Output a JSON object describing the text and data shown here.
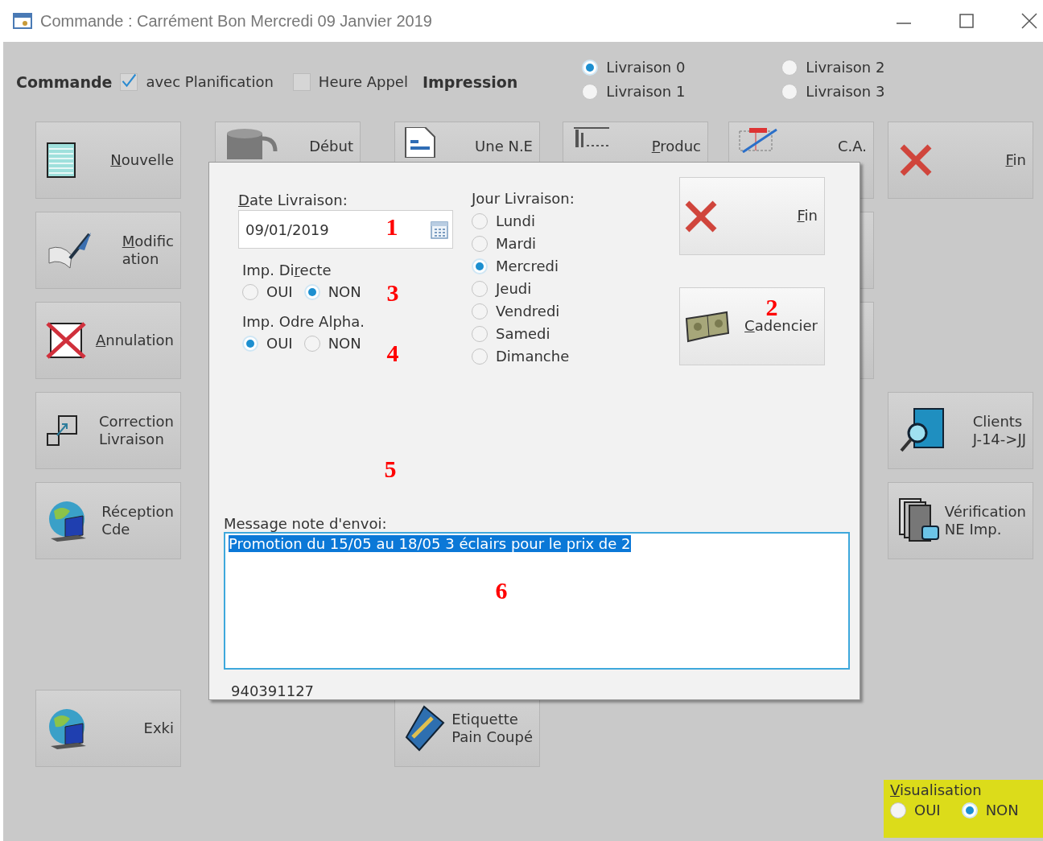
{
  "window": {
    "title": "Commande : Carrément Bon Mercredi 09 Janvier 2019"
  },
  "toolbar": {
    "title": "Commande",
    "options": [
      {
        "label": "avec Planification",
        "checked": true
      },
      {
        "label": "Heure Appel",
        "checked": false
      }
    ],
    "impression": "Impression",
    "livraisons": [
      {
        "label": "Livraison 0",
        "selected": true
      },
      {
        "label": "Livraison 1",
        "selected": false
      },
      {
        "label": "Livraison 2",
        "selected": false
      },
      {
        "label": "Livraison 3",
        "selected": false
      }
    ]
  },
  "buttons": [
    {
      "label": "Nouvelle",
      "kind": "list"
    },
    {
      "label": "Début",
      "kind": "cylinder"
    },
    {
      "label": "Une N.E",
      "kind": "document"
    },
    {
      "label": "Produc",
      "kind": "chart"
    },
    {
      "label": "C.A.",
      "kind": "grid"
    },
    {
      "label": "Fin",
      "kind": "cross"
    },
    {
      "label": "Modific\nation",
      "kind": "quill"
    },
    {
      "kind": "blank"
    },
    {
      "label": "Annulation",
      "kind": "cancel"
    },
    {
      "kind": "blank"
    },
    {
      "label": "Correction\nLivraison",
      "kind": "resize"
    },
    {
      "label": "Clients\n J-14->JJ",
      "kind": "search-doc"
    },
    {
      "label": "Réception\nCde",
      "kind": "globe"
    },
    {
      "label": "Vérification\nNE Imp.",
      "kind": "printer-docs"
    },
    {
      "label": "Exki",
      "kind": "globe"
    },
    {
      "label": "Etiquette\nPain Coupé",
      "kind": "tag"
    }
  ],
  "dialog": {
    "date": {
      "label": "Date Livraison:",
      "value": "09/01/2019"
    },
    "imp_directe": {
      "label": "Imp. Directe",
      "options": [
        {
          "label": "OUI",
          "selected": false
        },
        {
          "label": "NON",
          "selected": true
        }
      ]
    },
    "imp_ordre": {
      "label": "Imp. Odre Alpha.",
      "options": [
        {
          "label": "OUI",
          "selected": true
        },
        {
          "label": "NON",
          "selected": false
        }
      ]
    },
    "jour": {
      "label": "Jour Livraison:",
      "options": [
        {
          "label": "Lundi",
          "selected": false
        },
        {
          "label": "Mardi",
          "selected": false
        },
        {
          "label": "Mercredi",
          "selected": true
        },
        {
          "label": "Jeudi",
          "selected": false
        },
        {
          "label": "Vendredi",
          "selected": false
        },
        {
          "label": "Samedi",
          "selected": false
        },
        {
          "label": "Dimanche",
          "selected": false
        }
      ]
    },
    "buttons": [
      {
        "label": "Fin",
        "kind": "cross"
      },
      {
        "label": "Cadencier",
        "kind": "money"
      }
    ],
    "message": {
      "label": "Message note d'envoi:",
      "value": "Promotion du 15/05 au 18/05 3 éclairs pour le prix de 2"
    },
    "code": "940391127"
  },
  "visualisation": {
    "label": "Visualisation",
    "options": [
      {
        "label": "OUI",
        "selected": false
      },
      {
        "label": "NON",
        "selected": true
      }
    ]
  },
  "annotations": [
    "1",
    "2",
    "3",
    "4",
    "5",
    "6"
  ]
}
